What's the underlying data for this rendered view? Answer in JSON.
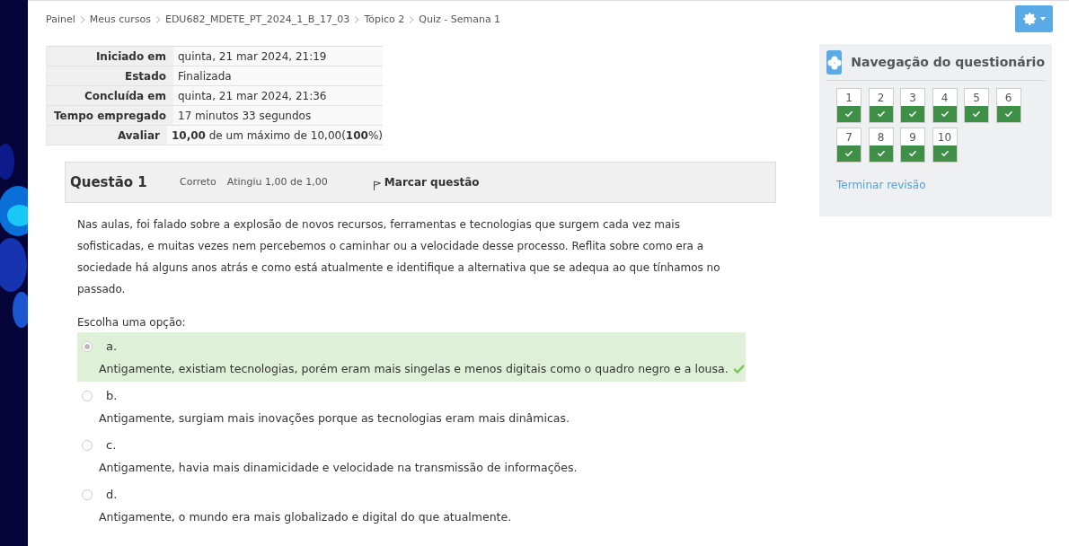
{
  "breadcrumb": [
    "Painel",
    "Meus cursos",
    "EDU682_MDETE_PT_2024_1_B_17_03",
    "Tópico 2",
    "Quiz - Semana 1"
  ],
  "summary": [
    {
      "label": "Iniciado em",
      "value": "quinta, 21 mar 2024, 21:19"
    },
    {
      "label": "Estado",
      "value": "Finalizada"
    },
    {
      "label": "Concluída em",
      "value": "quinta, 21 mar 2024, 21:36"
    },
    {
      "label": "Tempo empregado",
      "value": "17 minutos 33 segundos"
    },
    {
      "label": "Avaliar",
      "value": "**10,00** de um máximo de 10,00(**100**%)"
    }
  ],
  "question": {
    "title": "Questão 1",
    "status": "Correto",
    "grade": "Atingiu 1,00 de 1,00",
    "flag": "Marcar questão",
    "text": "Nas aulas, foi falado sobre a explosão de novos recursos, ferramentas e tecnologias que surgem cada vez mais sofisticadas, e muitas vezes nem percebemos o caminhar ou a velocidade desse processo. Reflita sobre como era a sociedade há alguns anos atrás e como está atualmente e identifique a alternativa que se adequa ao que tínhamos no passado.",
    "prompt": "Escolha uma opção:",
    "options": [
      {
        "letter": "a.",
        "text": "Antigamente, existiam tecnologias, porém eram mais singelas e menos digitais como o quadro negro e a lousa.",
        "selected": true,
        "correct": true
      },
      {
        "letter": "b.",
        "text": "Antigamente, surgiam mais inovações porque as tecnologias eram mais dinâmicas.",
        "selected": false,
        "correct": false
      },
      {
        "letter": "c.",
        "text": "Antigamente, havia mais dinamicidade e velocidade na transmissão de informações.",
        "selected": false,
        "correct": false
      },
      {
        "letter": "d.",
        "text": "Antigamente, o mundo era mais globalizado e digital do que atualmente.",
        "selected": false,
        "correct": false
      }
    ]
  },
  "navigation": {
    "title": "Navegação do questionário",
    "finish": "Terminar revisão",
    "questions": [
      {
        "number": "1",
        "correct": true
      },
      {
        "number": "2",
        "correct": true
      },
      {
        "number": "3",
        "correct": true
      },
      {
        "number": "4",
        "correct": true
      },
      {
        "number": "5",
        "correct": true
      },
      {
        "number": "6",
        "correct": true
      },
      {
        "number": "7",
        "correct": true
      },
      {
        "number": "8",
        "correct": true
      },
      {
        "number": "9",
        "correct": true
      },
      {
        "number": "10",
        "correct": true
      }
    ]
  }
}
